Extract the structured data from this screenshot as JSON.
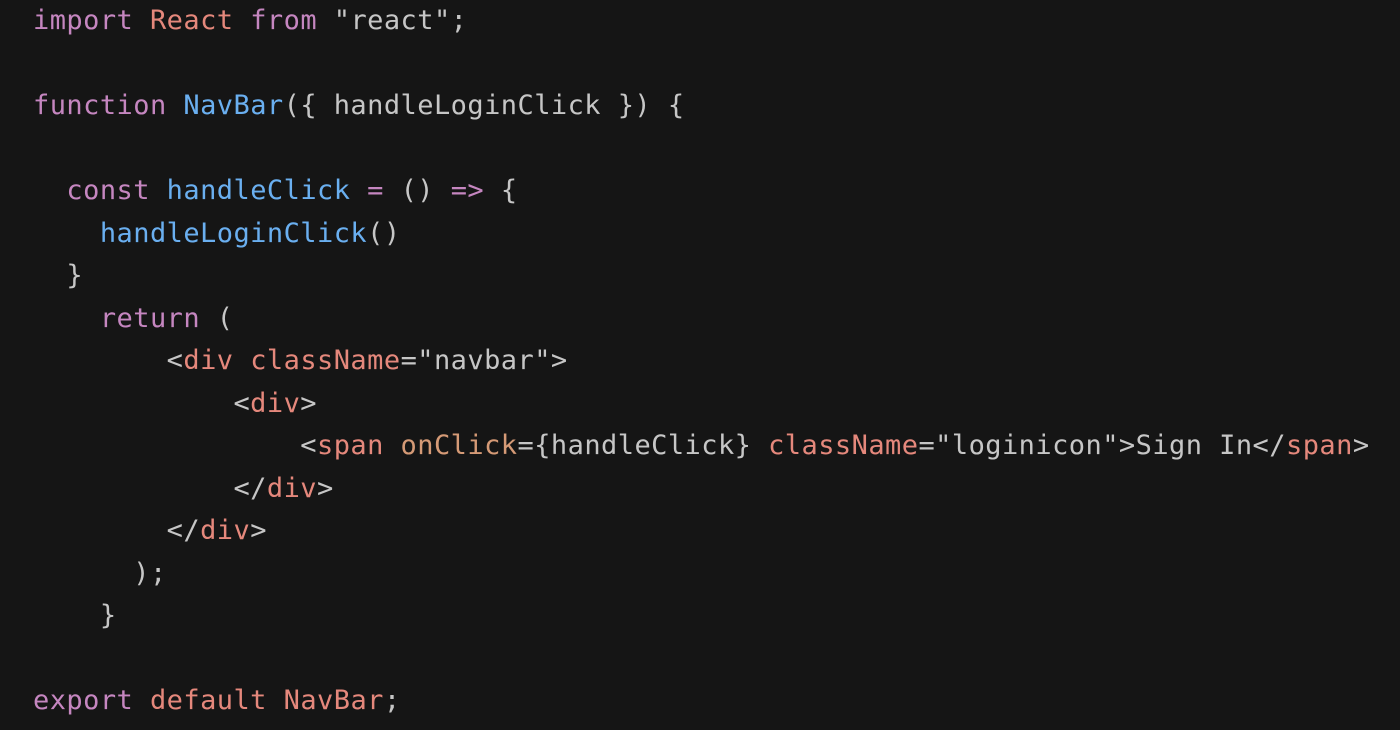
{
  "editor": {
    "lines": [
      [
        {
          "t": "import",
          "c": "#c586c0"
        },
        {
          "t": " ",
          "c": "#c6c6c6"
        },
        {
          "t": "React",
          "c": "#e5887c"
        },
        {
          "t": " ",
          "c": "#c6c6c6"
        },
        {
          "t": "from",
          "c": "#c586c0"
        },
        {
          "t": " \"react\";",
          "c": "#c6c6c6"
        }
      ],
      [],
      [
        {
          "t": "function",
          "c": "#c586c0"
        },
        {
          "t": " ",
          "c": "#c6c6c6"
        },
        {
          "t": "NavBar",
          "c": "#6aaff0"
        },
        {
          "t": "({ handleLoginClick }) {",
          "c": "#c6c6c6"
        }
      ],
      [],
      [
        {
          "t": "  ",
          "c": "#c6c6c6"
        },
        {
          "t": "const",
          "c": "#c586c0"
        },
        {
          "t": " ",
          "c": "#c6c6c6"
        },
        {
          "t": "handleClick",
          "c": "#6aaff0"
        },
        {
          "t": " ",
          "c": "#c6c6c6"
        },
        {
          "t": "=",
          "c": "#c586c0"
        },
        {
          "t": " () ",
          "c": "#c6c6c6"
        },
        {
          "t": "=>",
          "c": "#c586c0"
        },
        {
          "t": " {",
          "c": "#c6c6c6"
        }
      ],
      [
        {
          "t": "    ",
          "c": "#c6c6c6"
        },
        {
          "t": "handleLoginClick",
          "c": "#6aaff0"
        },
        {
          "t": "()",
          "c": "#c6c6c6"
        }
      ],
      [
        {
          "t": "  }",
          "c": "#c6c6c6"
        }
      ],
      [
        {
          "t": "    ",
          "c": "#c6c6c6"
        },
        {
          "t": "return",
          "c": "#c586c0"
        },
        {
          "t": " (",
          "c": "#c6c6c6"
        }
      ],
      [
        {
          "t": "        <",
          "c": "#c6c6c6"
        },
        {
          "t": "div",
          "c": "#e5887c"
        },
        {
          "t": " ",
          "c": "#c6c6c6"
        },
        {
          "t": "className",
          "c": "#e5887c"
        },
        {
          "t": "=\"navbar\">",
          "c": "#c6c6c6"
        }
      ],
      [
        {
          "t": "            <",
          "c": "#c6c6c6"
        },
        {
          "t": "div",
          "c": "#e5887c"
        },
        {
          "t": ">",
          "c": "#c6c6c6"
        }
      ],
      [
        {
          "t": "                <",
          "c": "#c6c6c6"
        },
        {
          "t": "span",
          "c": "#e5887c"
        },
        {
          "t": " ",
          "c": "#c6c6c6"
        },
        {
          "t": "onClick",
          "c": "#d59a76"
        },
        {
          "t": "={handleClick} ",
          "c": "#c6c6c6"
        },
        {
          "t": "className",
          "c": "#e5887c"
        },
        {
          "t": "=\"loginicon\">Sign In</",
          "c": "#c6c6c6"
        },
        {
          "t": "span",
          "c": "#e5887c"
        },
        {
          "t": ">",
          "c": "#c6c6c6"
        }
      ],
      [
        {
          "t": "            </",
          "c": "#c6c6c6"
        },
        {
          "t": "div",
          "c": "#e5887c"
        },
        {
          "t": ">",
          "c": "#c6c6c6"
        }
      ],
      [
        {
          "t": "        </",
          "c": "#c6c6c6"
        },
        {
          "t": "div",
          "c": "#e5887c"
        },
        {
          "t": ">",
          "c": "#c6c6c6"
        }
      ],
      [
        {
          "t": "      );",
          "c": "#c6c6c6"
        }
      ],
      [
        {
          "t": "    }",
          "c": "#c6c6c6"
        }
      ],
      [],
      [
        {
          "t": "export",
          "c": "#c586c0"
        },
        {
          "t": " ",
          "c": "#c6c6c6"
        },
        {
          "t": "default",
          "c": "#e5887c"
        },
        {
          "t": " ",
          "c": "#c6c6c6"
        },
        {
          "t": "NavBar",
          "c": "#e5887c"
        },
        {
          "t": ";",
          "c": "#c6c6c6"
        }
      ]
    ],
    "colors": {
      "background": "#151515",
      "keyword": "#c586c0",
      "function": "#6aaff0",
      "tag": "#e5887c",
      "attribute": "#d59a76",
      "text": "#c6c6c6"
    }
  }
}
